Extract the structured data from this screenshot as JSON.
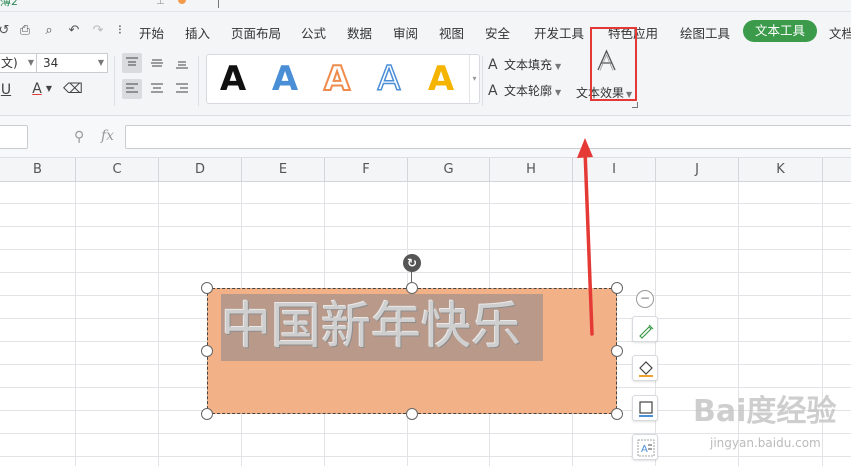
{
  "window": {
    "doc_tab_fragment": "薄2"
  },
  "menu": {
    "tabs": [
      "开始",
      "插入",
      "页面布局",
      "公式",
      "数据",
      "审阅",
      "视图",
      "安全",
      "开发工具",
      "特色应用",
      "绘图工具",
      "文本工具",
      "文档"
    ],
    "active_tab": "文本工具",
    "active_color": "#3c9b4b"
  },
  "ribbon": {
    "font_name_fragment": "文)",
    "font_size": "34",
    "underline_label": "U",
    "font_color_label": "A",
    "font_color": "#e53935",
    "art_styles": [
      {
        "letter": "A",
        "fill": "#111111",
        "outline": "none"
      },
      {
        "letter": "A",
        "fill": "#4a8ed6",
        "outline": "none"
      },
      {
        "letter": "A",
        "fill": "#ffffff",
        "outline": "#ef8b4c"
      },
      {
        "letter": "A",
        "fill": "#ffffff",
        "outline": "#4a8ed6"
      },
      {
        "letter": "A",
        "fill": "#f4b400",
        "outline": "none"
      }
    ],
    "text_fill_label": "文本填充",
    "text_outline_label": "文本轮廓",
    "text_effect_label": "文本效果",
    "highlight_color": "#e53935"
  },
  "formula_bar": {
    "fx_label": "fx",
    "value": ""
  },
  "sheet": {
    "columns": [
      "B",
      "C",
      "D",
      "E",
      "F",
      "G",
      "H",
      "I",
      "J",
      "K"
    ]
  },
  "textbox": {
    "text": "中国新年快乐",
    "fill_color": "#f2b186",
    "text_highlight_color": "#b9998a"
  },
  "annotation": {
    "arrow_color": "#e53935"
  },
  "watermark": {
    "logo": "Bai度经验",
    "url": "jingyan.baidu.com"
  }
}
